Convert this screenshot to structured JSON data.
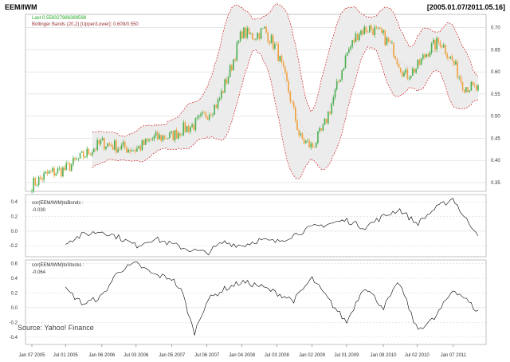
{
  "header": {
    "symbol": "EEM/IWM",
    "date_range": "[2005.01.07/2011.05.16]"
  },
  "legend": {
    "last_label": "Last 0.559327986389598",
    "bbands_label": "Bollinger Bands (20,2) [Upper/Lower]: 0.609/0.550"
  },
  "source": "Source: Yahoo! Finance",
  "colors": {
    "up": "#4caf50",
    "down": "#f0a040",
    "band_fill": "#ececec",
    "band_edge": "#cc0000",
    "band_mid": "#c0c0c0",
    "last_text": "#22aa22",
    "bb_text": "#993333",
    "line": "#000000",
    "grid": "#cfcfcf"
  },
  "chart_data": [
    {
      "type": "candlestick",
      "panel": "price",
      "ylim": [
        0.33,
        0.73
      ],
      "yticks": [
        "0.35",
        "0.40",
        "0.45",
        "0.50",
        "0.55",
        "0.60",
        "0.65",
        "0.70"
      ],
      "overlay": "Bollinger Bands (20,2)",
      "series": [
        {
          "name": "EEM/IWM",
          "x": [
            "2005-01-07",
            "2005-04-01",
            "2005-07-01",
            "2005-10-01",
            "2006-01-06",
            "2006-04-01",
            "2006-07-03",
            "2006-10-02",
            "2007-01-05",
            "2007-03-01",
            "2007-05-01",
            "2007-07-06",
            "2007-09-01",
            "2007-11-01",
            "2008-01-04",
            "2008-03-01",
            "2008-05-01",
            "2008-07-03",
            "2008-09-01",
            "2008-11-01",
            "2009-01-02",
            "2009-03-01",
            "2009-05-01",
            "2009-07-01",
            "2009-09-01",
            "2009-11-01",
            "2010-01-08",
            "2010-03-01",
            "2010-05-01",
            "2010-07-02",
            "2010-09-01",
            "2010-11-01",
            "2011-01-07",
            "2011-03-01",
            "2011-05-16"
          ],
          "values": [
            0.345,
            0.37,
            0.38,
            0.41,
            0.44,
            0.43,
            0.425,
            0.45,
            0.455,
            0.47,
            0.48,
            0.505,
            0.53,
            0.6,
            0.69,
            0.68,
            0.695,
            0.65,
            0.56,
            0.45,
            0.43,
            0.47,
            0.55,
            0.64,
            0.69,
            0.7,
            0.68,
            0.65,
            0.59,
            0.61,
            0.65,
            0.67,
            0.62,
            0.57,
            0.559
          ]
        }
      ]
    },
    {
      "type": "line",
      "panel": "cor1",
      "title": "cor(EEM/IWM)toBonds :",
      "last_value": "-0.030",
      "ylim": [
        -0.35,
        0.5
      ],
      "yticks": [
        "0.4",
        "0.2",
        "0.0",
        "-0.2"
      ],
      "x": [
        "2005-07-01",
        "2005-10-01",
        "2006-01-06",
        "2006-04-01",
        "2006-07-03",
        "2006-10-02",
        "2007-01-05",
        "2007-04-01",
        "2007-07-06",
        "2007-10-01",
        "2008-01-04",
        "2008-04-01",
        "2008-07-03",
        "2008-10-01",
        "2009-01-02",
        "2009-04-01",
        "2009-07-01",
        "2009-10-01",
        "2010-01-08",
        "2010-04-01",
        "2010-07-02",
        "2010-10-01",
        "2011-01-07",
        "2011-03-01",
        "2011-05-16"
      ],
      "values": [
        -0.15,
        -0.05,
        0.0,
        -0.08,
        -0.2,
        -0.1,
        -0.18,
        -0.25,
        -0.3,
        -0.15,
        -0.2,
        -0.12,
        -0.15,
        -0.05,
        0.05,
        0.1,
        0.15,
        0.05,
        0.2,
        0.3,
        0.1,
        0.3,
        0.45,
        0.2,
        -0.03
      ]
    },
    {
      "type": "line",
      "panel": "cor2",
      "title": "cor(EEM/IWM)toStocks :",
      "last_value": "-0.064",
      "ylim": [
        -0.5,
        0.65
      ],
      "yticks": [
        "0.6",
        "0.4",
        "0.2",
        "0.0",
        "-0.2",
        "-0.4"
      ],
      "x": [
        "2005-07-01",
        "2005-10-01",
        "2006-01-06",
        "2006-04-01",
        "2006-07-03",
        "2006-10-02",
        "2007-01-05",
        "2007-03-01",
        "2007-05-01",
        "2007-07-06",
        "2007-10-01",
        "2008-01-04",
        "2008-04-01",
        "2008-07-03",
        "2008-10-01",
        "2009-01-02",
        "2009-04-01",
        "2009-07-01",
        "2009-10-01",
        "2010-01-08",
        "2010-04-01",
        "2010-07-02",
        "2010-10-01",
        "2011-01-07",
        "2011-03-01",
        "2011-05-16"
      ],
      "values": [
        0.25,
        0.05,
        0.15,
        0.5,
        0.6,
        0.45,
        0.4,
        0.2,
        -0.35,
        0.1,
        0.25,
        0.35,
        0.3,
        0.2,
        0.1,
        0.4,
        0.1,
        -0.2,
        0.3,
        0.0,
        0.35,
        -0.3,
        -0.15,
        0.25,
        0.15,
        -0.06
      ]
    }
  ],
  "x_axis": {
    "ticks": [
      {
        "date": "2005-01-07",
        "label": "Jan 07 2005"
      },
      {
        "date": "2005-07-01",
        "label": "Jul 01 2005"
      },
      {
        "date": "2006-01-06",
        "label": "Jan 06 2006"
      },
      {
        "date": "2006-07-03",
        "label": "Jul 03 2006"
      },
      {
        "date": "2007-01-05",
        "label": "Jan 05 2007"
      },
      {
        "date": "2007-07-06",
        "label": "Jul 06 2007"
      },
      {
        "date": "2008-01-04",
        "label": "Jan 04 2008"
      },
      {
        "date": "2008-07-03",
        "label": "Jul 03 2008"
      },
      {
        "date": "2009-01-02",
        "label": "Jan 02 2009"
      },
      {
        "date": "2009-07-01",
        "label": "Jul 01 2009"
      },
      {
        "date": "2010-01-08",
        "label": "Jan 08 2010"
      },
      {
        "date": "2010-07-02",
        "label": "Jul 02 2010"
      },
      {
        "date": "2011-01-07",
        "label": "Jan 07 2011"
      }
    ]
  }
}
